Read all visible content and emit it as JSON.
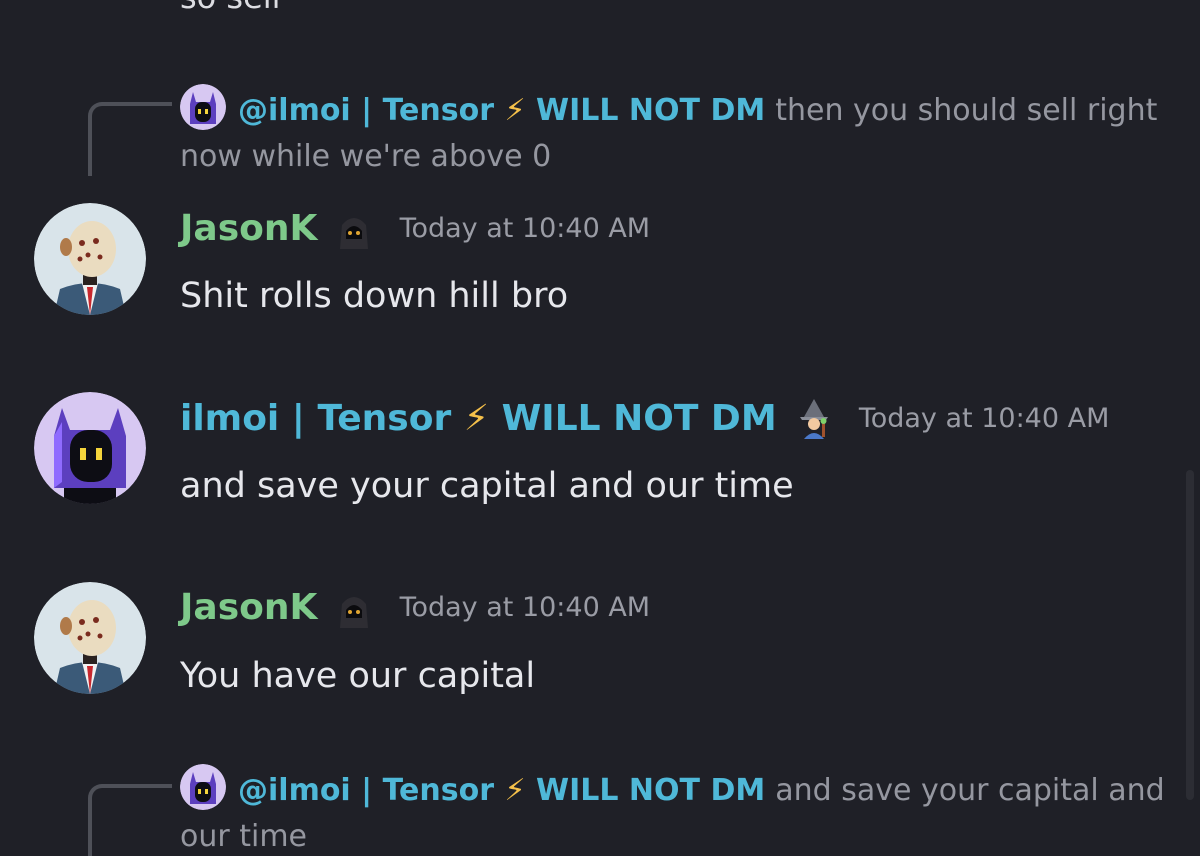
{
  "top_cut_text": "so sell",
  "messages": [
    {
      "reply": {
        "mention": "@ilmoi | Tensor",
        "mention_suffix": "WILL NOT DM",
        "text": "then you should sell right now while we're above 0"
      }
    },
    {
      "username": "JasonK",
      "timestamp": "Today at 10:40 AM",
      "text": "Shit rolls down hill bro"
    },
    {
      "username": "ilmoi | Tensor",
      "username_suffix": "WILL NOT DM",
      "timestamp": "Today at 10:40 AM",
      "text": "and save your capital and our time"
    },
    {
      "username": "JasonK",
      "timestamp": "Today at 10:40 AM",
      "text": "You have our capital"
    },
    {
      "reply": {
        "mention": "@ilmoi | Tensor",
        "mention_suffix": "WILL NOT DM",
        "text": "and save your capital and our time"
      }
    }
  ],
  "icons": {
    "bolt": "⚡",
    "jason_role": "hooded-figure-icon",
    "ilmoi_role": "mage-icon"
  },
  "colors": {
    "background": "#1f2027",
    "jason_name": "#7ec98a",
    "ilmoi_name": "#4fb8d8",
    "message_text": "#e6e7ec",
    "timestamp": "#9a9ca5"
  }
}
